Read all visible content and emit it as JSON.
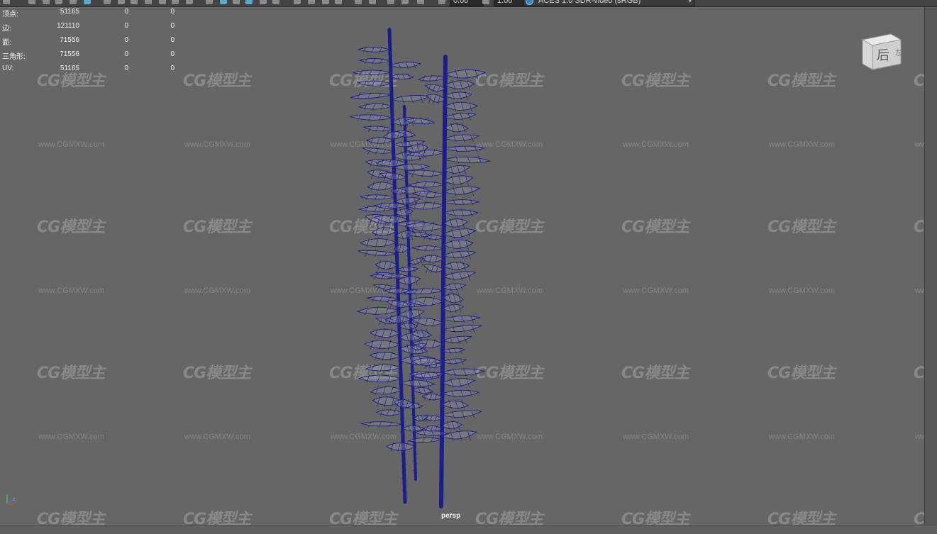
{
  "toolbar": {
    "exposure_value": "0.00",
    "gamma_value": "1.00",
    "color_management_label": "ACES 1.0 SDR-video (sRGB)",
    "color_management_icon": "color-management-icon",
    "chevron_icon": "chevron-down-icon"
  },
  "hud": {
    "rows": [
      {
        "label": "顶点:",
        "v1": "51165",
        "v2": "0",
        "v3": "0"
      },
      {
        "label": "边:",
        "v1": "121110",
        "v2": "0",
        "v3": "0"
      },
      {
        "label": "面:",
        "v1": "71556",
        "v2": "0",
        "v3": "0"
      },
      {
        "label": "三角形:",
        "v1": "71556",
        "v2": "0",
        "v3": "0"
      },
      {
        "label": "UV:",
        "v1": "51165",
        "v2": "0",
        "v3": "0"
      }
    ]
  },
  "viewcube": {
    "face_label": "后",
    "side_label": "左"
  },
  "camera_label": "persp",
  "watermark": {
    "logo": "CG模型主",
    "url": "www.CGMXW.com"
  },
  "axis": {
    "x_label": "x",
    "y_label": "y",
    "z_label": "z"
  },
  "colors": {
    "viewport_bg": "#666666",
    "wireframe": "#1c1e8a",
    "hud_text": "#f0f0f0",
    "toolbar_bg": "#444444"
  }
}
